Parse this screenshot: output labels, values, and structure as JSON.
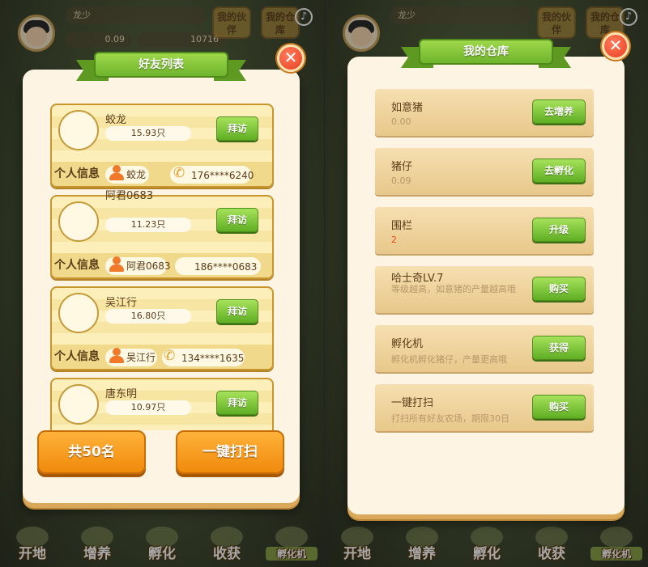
{
  "left": {
    "hud": {
      "player_name": "龙少",
      "stat_a": "0.09",
      "stat_b": "10716",
      "btn_partner": "我的伙伴",
      "btn_warehouse": "我的仓库",
      "music_icon": "music-note"
    },
    "dialog": {
      "title": "好友列表",
      "friends": [
        {
          "name": "蛟龙",
          "count": "15.93只",
          "visit": "拜访",
          "info_label": "个人信息",
          "nick": "蛟龙",
          "phone": "176****6240"
        },
        {
          "name": "阿君0683",
          "count": "11.23只",
          "visit": "拜访",
          "info_label": "个人信息",
          "nick": "阿君0683",
          "phone": "186****0683"
        },
        {
          "name": "吴江行",
          "count": "16.80只",
          "visit": "拜访",
          "info_label": "个人信息",
          "nick": "吴江行",
          "phone": "134****1635"
        },
        {
          "name": "唐东明",
          "count": "10.97只",
          "visit": "拜访"
        }
      ],
      "total_btn": "共50名",
      "sweep_btn": "一键打扫"
    }
  },
  "right": {
    "hud": {
      "player_name": "龙少",
      "btn_partner": "我的伙伴",
      "btn_warehouse": "我的仓库",
      "music_icon": "music-note"
    },
    "dialog": {
      "title": "我的仓库",
      "items": [
        {
          "name": "如意猪",
          "sub": "0.00",
          "btn": "去增养"
        },
        {
          "name": "猪仔",
          "sub": "0.09",
          "btn": "去孵化"
        },
        {
          "name": "围栏",
          "sub": "2",
          "btn": "升级"
        },
        {
          "name": "哈士奇LV.7",
          "sub": "等级越高，如意猪的产量越高哦",
          "btn": "购买"
        },
        {
          "name": "孵化机",
          "sub": "孵化机孵化猪仔，产量更高哦",
          "btn": "获得"
        },
        {
          "name": "一键打扫",
          "sub": "打扫所有好友农场，期限30日",
          "btn": "购买"
        }
      ]
    }
  },
  "nav": [
    "开地",
    "增养",
    "孵化",
    "收获",
    "孵化机"
  ],
  "colors": {
    "accent_green": "#6fb42c",
    "accent_orange": "#f08a0c",
    "close_red": "#e8401f"
  }
}
